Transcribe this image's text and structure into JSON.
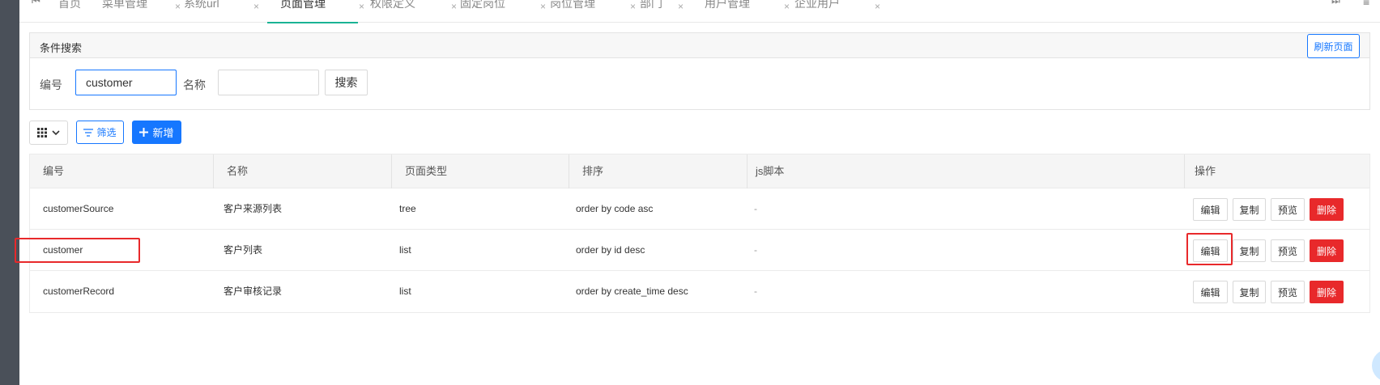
{
  "tabs": {
    "first_icon": "⏮",
    "last_icon": "⏭",
    "menu_icon": "≡",
    "close_glyph": "×",
    "items": [
      {
        "label": "首页"
      },
      {
        "label": "菜单管理"
      },
      {
        "label": "系统url"
      },
      {
        "label": "页面管理",
        "active": true
      },
      {
        "label": "权限定义"
      },
      {
        "label": "固定岗位"
      },
      {
        "label": "岗位管理"
      },
      {
        "label": "部门"
      },
      {
        "label": "用户管理"
      },
      {
        "label": "企业用户"
      }
    ]
  },
  "search": {
    "title": "条件搜索",
    "refresh_label": "刷新页面",
    "code_label": "编号",
    "code_value": "customer",
    "name_label": "名称",
    "name_value": "",
    "search_label": "搜索"
  },
  "toolbar": {
    "filter_label": "筛选",
    "add_label": "新增"
  },
  "table": {
    "headers": [
      "编号",
      "名称",
      "页面类型",
      "排序",
      "js脚本",
      "操作"
    ],
    "rows": [
      {
        "code": "customerSource",
        "name": "客户来源列表",
        "type": "tree",
        "order": "order by code asc",
        "js": "-"
      },
      {
        "code": "customer",
        "name": "客户列表",
        "type": "list",
        "order": "order by id desc",
        "js": "-"
      },
      {
        "code": "customerRecord",
        "name": "客户审核记录",
        "type": "list",
        "order": "order by create_time desc",
        "js": "-"
      }
    ],
    "actions": {
      "edit": "编辑",
      "copy": "复制",
      "preview": "预览",
      "delete": "删除"
    }
  },
  "colors": {
    "primary": "#1677ff",
    "danger": "#e8292b",
    "sidebar": "#4a5059",
    "tab_accent": "#1ab394"
  }
}
